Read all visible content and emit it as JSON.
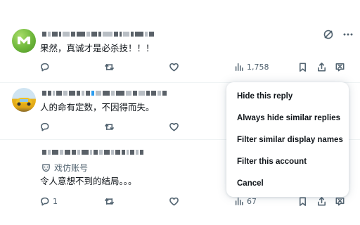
{
  "feed": {
    "posts": [
      {
        "text": "果然，真诚才是必杀技！！！",
        "actions": {
          "views": "1,758"
        }
      },
      {
        "text": "人的命有定数，不因得而失。",
        "actions": {}
      },
      {
        "tag": "戏仿账号",
        "text": "令人意想不到的结局。。。",
        "actions": {
          "replies": "1",
          "views": "67"
        }
      }
    ]
  },
  "menu": {
    "items": [
      "Hide this reply",
      "Always hide similar replies",
      "Filter similar display names",
      "Filter this account",
      "Cancel"
    ]
  },
  "colors": {
    "text": "#0f1419",
    "muted": "#536471",
    "separator": "#eff3f4"
  },
  "icons": [
    "reply-icon",
    "repost-icon",
    "like-icon",
    "views-icon",
    "bookmark-icon",
    "share-icon",
    "hide-reply-icon",
    "grok-icon",
    "more-icon",
    "parody-mask-icon"
  ]
}
